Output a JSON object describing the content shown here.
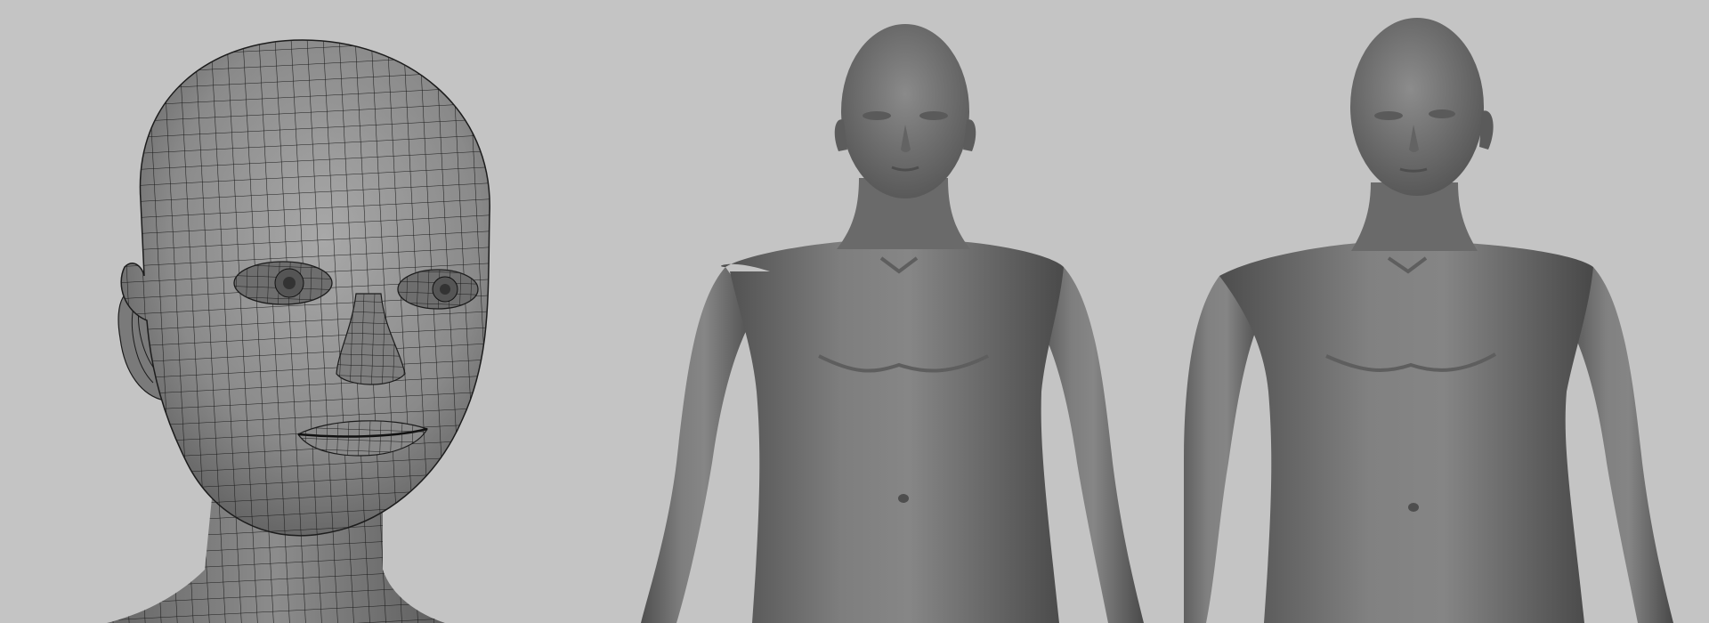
{
  "viewport": {
    "background": "#c4c4c4"
  },
  "panels": [
    {
      "id": "wireframe-head",
      "content": "head-wireframe-render"
    },
    {
      "id": "body-front",
      "content": "full-body-front-render"
    },
    {
      "id": "body-three-quarter",
      "content": "full-body-three-quarter-render"
    }
  ],
  "colors": {
    "mesh_fill": "#7c7c7c",
    "mesh_shadow": "#5a5a5a",
    "mesh_highlight": "#9a9a9a",
    "wire": "#1c1c1c"
  }
}
